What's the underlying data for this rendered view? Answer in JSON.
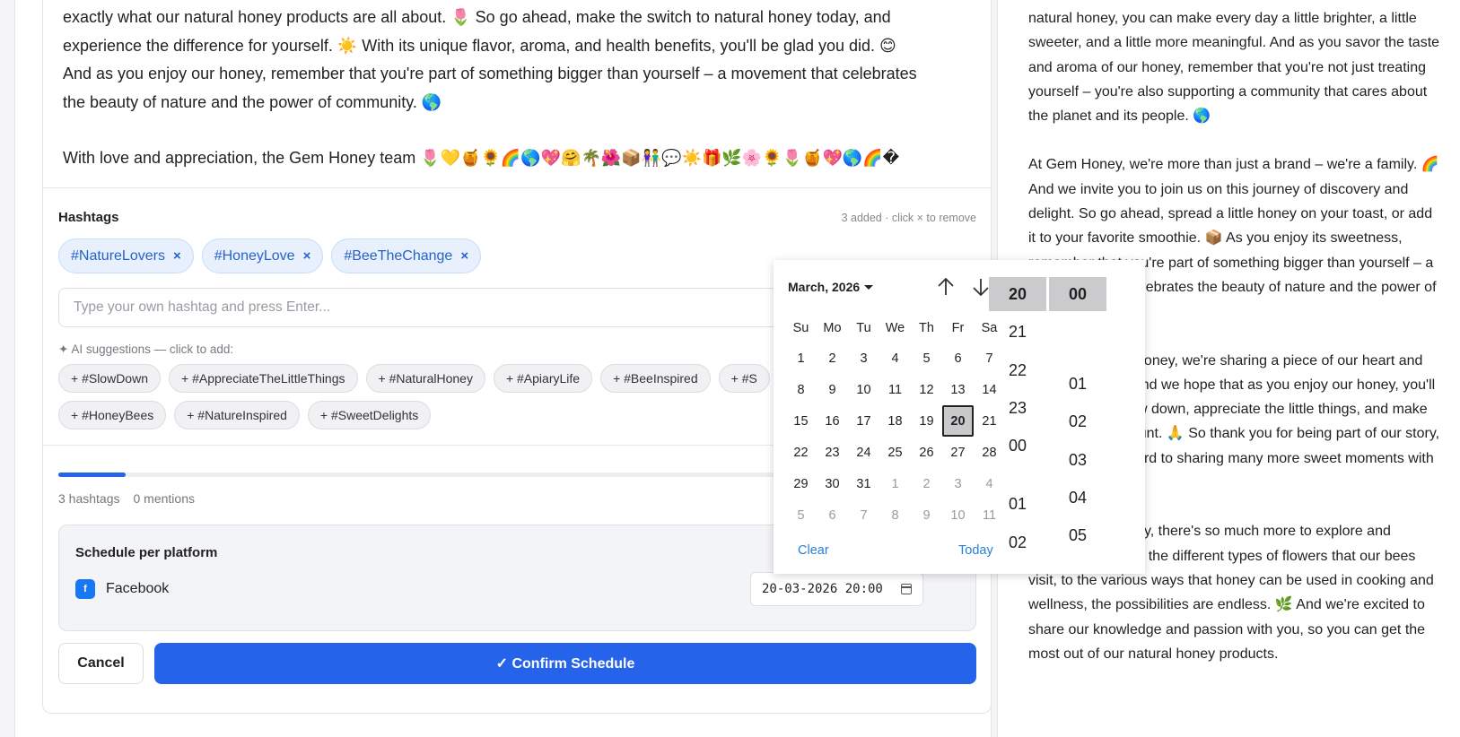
{
  "composer": {
    "body_lines": [
      "exactly what our natural honey products are all about. 🌷 So go ahead, make the switch to natural honey today, and",
      "experience the difference for yourself. ☀️ With its unique flavor, aroma, and health benefits, you'll be glad you did. 😊",
      "And as you enjoy our honey, remember that you're part of something bigger than yourself – a movement that celebrates",
      "the beauty of nature and the power of community. 🌎"
    ],
    "signature": "With love and appreciation, the Gem Honey team 🌷💛🍯🌻🌈🌎💖🤗🌴🌺📦👫💬☀️🎁🌿🌸🌻🌷🍯💖🌎🌈�"
  },
  "hashtags": {
    "label": "Hashtags",
    "hint": "3 added · click × to remove",
    "chips": [
      "#NatureLovers",
      "#HoneyLove",
      "#BeeTheChange"
    ],
    "remove_glyph": "×",
    "input_placeholder": "Type your own hashtag and press Enter...",
    "ai_label": "✦ AI suggestions — click to add:",
    "suggestions_row1": [
      "+ #SlowDown",
      "+ #AppreciateTheLittleThings",
      "+ #NaturalHoney",
      "+ #ApiaryLife",
      "+ #BeeInspired",
      "+ #S"
    ],
    "suggestions_row2": [
      "+ #HoneyBees",
      "+ #NatureInspired",
      "+ #SweetDelights"
    ]
  },
  "progress": {
    "fraction": 0.073
  },
  "stats": {
    "hashtags": "3 hashtags",
    "mentions": "0 mentions"
  },
  "schedule": {
    "title": "Schedule per platform",
    "platform_icon": "f",
    "platform": "Facebook",
    "datetime_value": "20-03-2026 20:00"
  },
  "buttons": {
    "cancel": "Cancel",
    "confirm": "✓ Confirm Schedule"
  },
  "side": {
    "paragraphs": [
      "natural honey, you can make every day a little brighter, a little sweeter, and a little more meaningful. And as you savor the taste and aroma of our honey, remember that you're not just treating yourself – you're also supporting a community that cares about the planet and its people. 🌎",
      "At Gem Honey, we're more than just a brand – we're a family. 🌈 And we invite you to join us on this journey of discovery and delight. So go ahead, spread a little honey on your toast, or add it to your favorite smoothie. 📦 As you enjoy its sweetness, remember that you're part of something bigger than yourself – a movement that celebrates the beauty of nature and the power of community.",
      "With every jar of honey, we're sharing a piece of our heart and our passion. 🌷 And we hope that as you enjoy our honey, you'll be inspired to slow down, appreciate the little things, and make every moment count. 🙏 So thank you for being part of our story, and we look forward to sharing many more sweet moments with you. 🌻🍯💛",
      "And with our honey, there's so much more to explore and discover. ☀️ From the different types of flowers that our bees visit, to the various ways that honey can be used in cooking and wellness, the possibilities are endless. 🌿 And we're excited to share our knowledge and passion with you, so you can get the most out of our natural honey products."
    ]
  },
  "picker": {
    "month_label": "March, 2026",
    "weekdays": [
      "Su",
      "Mo",
      "Tu",
      "We",
      "Th",
      "Fr",
      "Sa"
    ],
    "weeks": [
      [
        {
          "d": "1"
        },
        {
          "d": "2"
        },
        {
          "d": "3"
        },
        {
          "d": "4"
        },
        {
          "d": "5"
        },
        {
          "d": "6"
        },
        {
          "d": "7"
        }
      ],
      [
        {
          "d": "8"
        },
        {
          "d": "9"
        },
        {
          "d": "10"
        },
        {
          "d": "11"
        },
        {
          "d": "12"
        },
        {
          "d": "13"
        },
        {
          "d": "14"
        }
      ],
      [
        {
          "d": "15"
        },
        {
          "d": "16"
        },
        {
          "d": "17"
        },
        {
          "d": "18"
        },
        {
          "d": "19"
        },
        {
          "d": "20",
          "selected": true
        },
        {
          "d": "21"
        }
      ],
      [
        {
          "d": "22"
        },
        {
          "d": "23"
        },
        {
          "d": "24"
        },
        {
          "d": "25"
        },
        {
          "d": "26"
        },
        {
          "d": "27"
        },
        {
          "d": "28"
        }
      ],
      [
        {
          "d": "29"
        },
        {
          "d": "30"
        },
        {
          "d": "31"
        },
        {
          "d": "1",
          "muted": true
        },
        {
          "d": "2",
          "muted": true
        },
        {
          "d": "3",
          "muted": true
        },
        {
          "d": "4",
          "muted": true
        }
      ],
      [
        {
          "d": "5",
          "muted": true
        },
        {
          "d": "6",
          "muted": true
        },
        {
          "d": "7",
          "muted": true
        },
        {
          "d": "8",
          "muted": true
        },
        {
          "d": "9",
          "muted": true
        },
        {
          "d": "10",
          "muted": true
        },
        {
          "d": "11",
          "muted": true
        }
      ]
    ],
    "clear_label": "Clear",
    "today_label": "Today",
    "hours": [
      {
        "v": "20",
        "selected": true
      },
      {
        "v": "21"
      },
      {
        "v": "22"
      },
      {
        "v": "23"
      },
      {
        "v": "00"
      },
      {
        "v": "01"
      },
      {
        "v": "02"
      }
    ],
    "minutes": [
      {
        "v": "00",
        "selected": true
      },
      {
        "v": "01"
      },
      {
        "v": "02"
      },
      {
        "v": "03"
      },
      {
        "v": "04"
      },
      {
        "v": "05"
      }
    ]
  },
  "colors": {
    "accent": "#2563eb",
    "chip_bg": "#e8f0fd",
    "link": "#2a7ed8",
    "facebook": "#1877f2"
  }
}
